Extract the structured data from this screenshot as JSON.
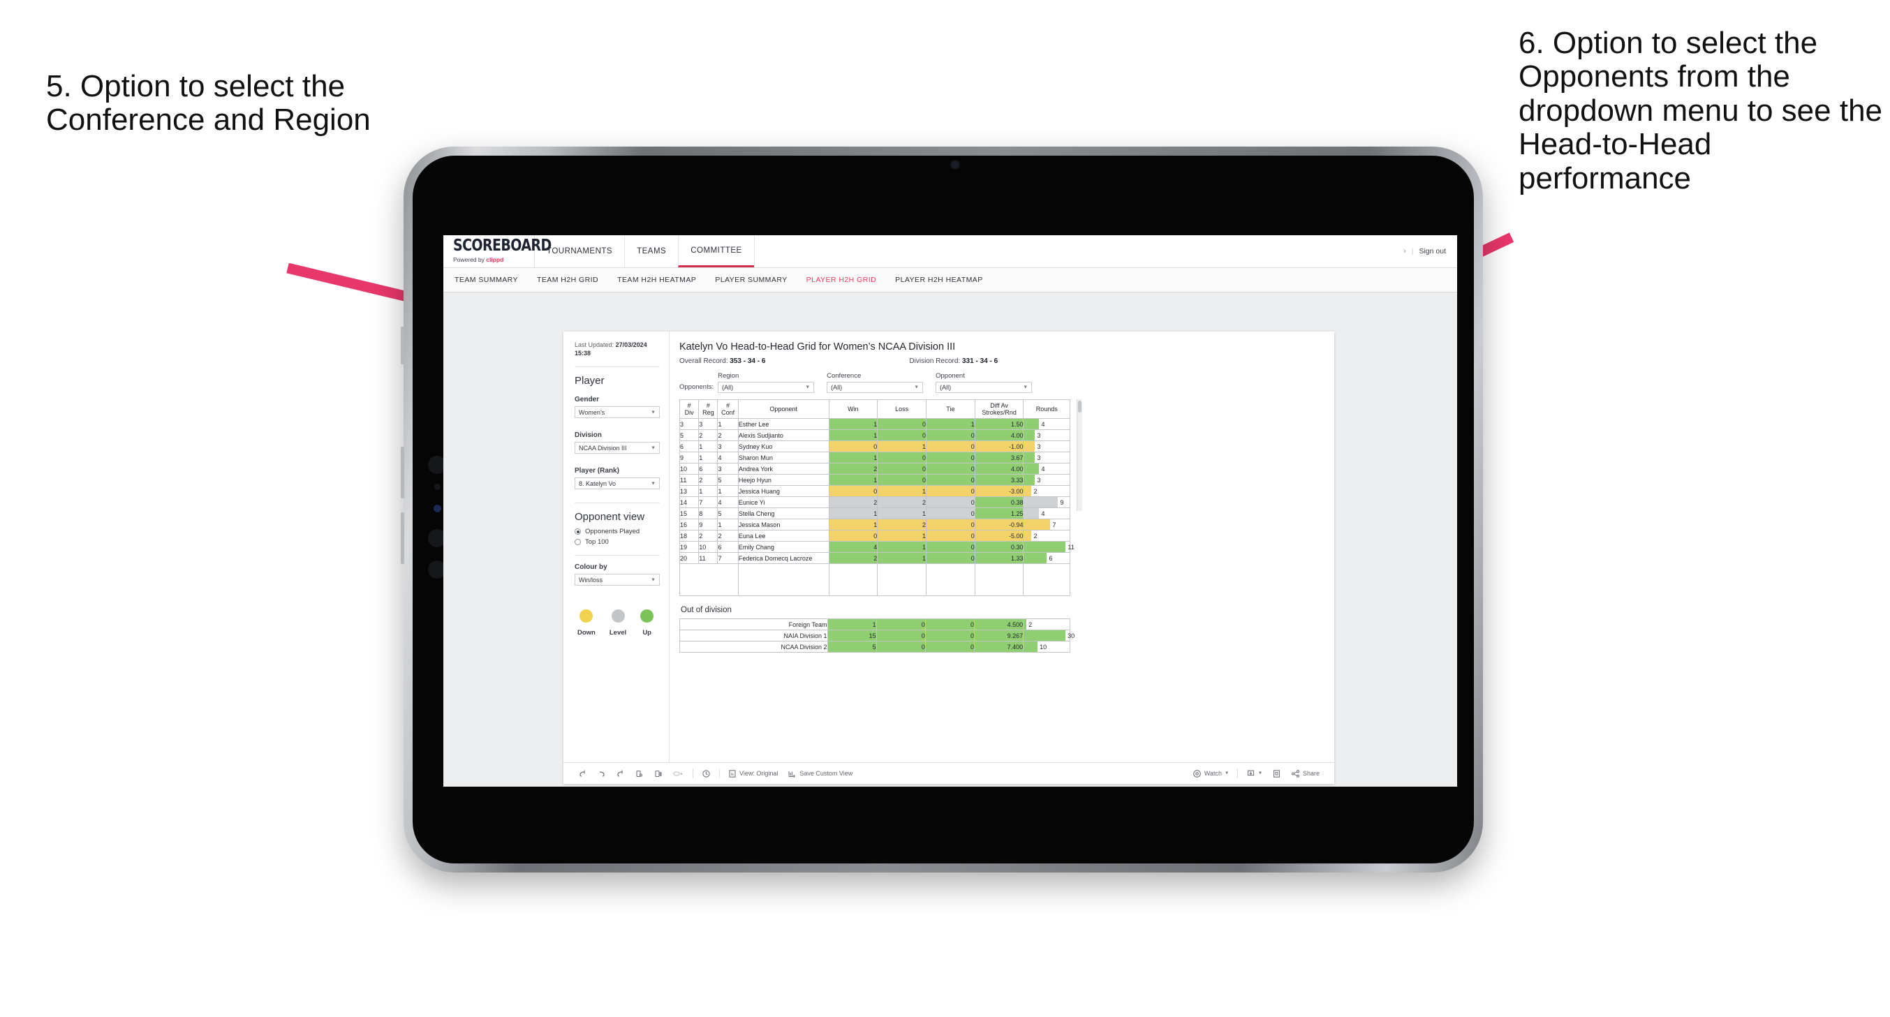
{
  "annotations": {
    "left": "5. Option to select the Conference and Region",
    "right": "6. Option to select the Opponents from the dropdown menu to see the Head-to-Head performance",
    "arrow_color": "#e8376b"
  },
  "app": {
    "brand": {
      "name": "SCOREBOARD",
      "powered_prefix": "Powered by ",
      "powered_brand": "clippd"
    },
    "nav": [
      {
        "label": "TOURNAMENTS",
        "active": false
      },
      {
        "label": "TEAMS",
        "active": false
      },
      {
        "label": "COMMITTEE",
        "active": true
      }
    ],
    "nav_right": {
      "chevron": "›",
      "separator": "|",
      "sign_out": "Sign out"
    },
    "subnav": [
      {
        "label": "TEAM SUMMARY",
        "active": false
      },
      {
        "label": "TEAM H2H GRID",
        "active": false
      },
      {
        "label": "TEAM H2H HEATMAP",
        "active": false
      },
      {
        "label": "PLAYER SUMMARY",
        "active": false
      },
      {
        "label": "PLAYER H2H GRID",
        "active": true
      },
      {
        "label": "PLAYER H2H HEATMAP",
        "active": false
      }
    ],
    "accent": "#ef3b5f"
  },
  "rail": {
    "last_updated_label": "Last Updated:",
    "last_updated_value": "27/03/2024 15:38",
    "player_heading": "Player",
    "gender_label": "Gender",
    "gender_value": "Women’s",
    "division_label": "Division",
    "division_value": "NCAA Division III",
    "player_rank_label": "Player (Rank)",
    "player_rank_value": "8. Katelyn Vo",
    "opponent_view_heading": "Opponent view",
    "opponent_view_options": [
      {
        "label": "Opponents Played",
        "selected": true
      },
      {
        "label": "Top 100",
        "selected": false
      }
    ],
    "colour_by_label": "Colour by",
    "colour_by_value": "Win/loss",
    "legend": [
      {
        "label": "Down",
        "color": "#f2d24f"
      },
      {
        "label": "Level",
        "color": "#c3c6c9"
      },
      {
        "label": "Up",
        "color": "#7cc35a"
      }
    ]
  },
  "viz": {
    "title": "Katelyn Vo Head-to-Head Grid for Women’s NCAA Division III",
    "overall_record_label": "Overall Record:",
    "overall_record_value": "353 - 34 - 6",
    "division_record_label": "Division Record:",
    "division_record_value": "331 - 34 - 6",
    "opponents_label": "Opponents:",
    "filters": [
      {
        "label": "Region",
        "value": "(All)"
      },
      {
        "label": "Conference",
        "value": "(All)"
      },
      {
        "label": "Opponent",
        "value": "(All)"
      }
    ],
    "out_of_division_heading": "Out of division"
  },
  "chart_data": {
    "type": "table",
    "title": "Katelyn Vo Head-to-Head Grid for Women’s NCAA Division III",
    "columns": [
      "# Div",
      "# Reg",
      "# Conf",
      "Opponent",
      "Win",
      "Loss",
      "Tie",
      "Diff Av Strokes/Rnd",
      "Rounds"
    ],
    "column_headers_multiline": [
      [
        "#",
        "Div"
      ],
      [
        "#",
        "Reg"
      ],
      [
        "#",
        "Conf"
      ],
      [
        "Opponent"
      ],
      [
        "Win"
      ],
      [
        "Loss"
      ],
      [
        "Tie"
      ],
      [
        "Diff Av",
        "Strokes/Rnd"
      ],
      [
        "Rounds"
      ]
    ],
    "rounds_max": 11,
    "colour_legend": {
      "up": "#8fce71",
      "down": "#f3d368",
      "level": "#cfd1d3"
    },
    "rows": [
      {
        "div": "3",
        "reg": "3",
        "conf": "1",
        "opponent": "Esther Lee",
        "win": "1",
        "loss": "0",
        "tie": "1",
        "diff": "1.50",
        "rounds": "4",
        "state": "up"
      },
      {
        "div": "5",
        "reg": "2",
        "conf": "2",
        "opponent": "Alexis Sudjianto",
        "win": "1",
        "loss": "0",
        "tie": "0",
        "diff": "4.00",
        "rounds": "3",
        "state": "up"
      },
      {
        "div": "6",
        "reg": "1",
        "conf": "3",
        "opponent": "Sydney Kuo",
        "win": "0",
        "loss": "1",
        "tie": "0",
        "diff": "-1.00",
        "rounds": "3",
        "state": "down"
      },
      {
        "div": "9",
        "reg": "1",
        "conf": "4",
        "opponent": "Sharon Mun",
        "win": "1",
        "loss": "0",
        "tie": "0",
        "diff": "3.67",
        "rounds": "3",
        "state": "up"
      },
      {
        "div": "10",
        "reg": "6",
        "conf": "3",
        "opponent": "Andrea York",
        "win": "2",
        "loss": "0",
        "tie": "0",
        "diff": "4.00",
        "rounds": "4",
        "state": "up"
      },
      {
        "div": "11",
        "reg": "2",
        "conf": "5",
        "opponent": "Heejo Hyun",
        "win": "1",
        "loss": "0",
        "tie": "0",
        "diff": "3.33",
        "rounds": "3",
        "state": "up"
      },
      {
        "div": "13",
        "reg": "1",
        "conf": "1",
        "opponent": "Jessica Huang",
        "win": "0",
        "loss": "1",
        "tie": "0",
        "diff": "-3.00",
        "rounds": "2",
        "state": "down"
      },
      {
        "div": "14",
        "reg": "7",
        "conf": "4",
        "opponent": "Eunice Yi",
        "win": "2",
        "loss": "2",
        "tie": "0",
        "diff": "0.38",
        "rounds": "9",
        "state": "level",
        "diff_state": "up"
      },
      {
        "div": "15",
        "reg": "8",
        "conf": "5",
        "opponent": "Stella Cheng",
        "win": "1",
        "loss": "1",
        "tie": "0",
        "diff": "1.25",
        "rounds": "4",
        "state": "level",
        "diff_state": "up"
      },
      {
        "div": "16",
        "reg": "9",
        "conf": "1",
        "opponent": "Jessica Mason",
        "win": "1",
        "loss": "2",
        "tie": "0",
        "diff": "-0.94",
        "rounds": "7",
        "state": "down"
      },
      {
        "div": "18",
        "reg": "2",
        "conf": "2",
        "opponent": "Euna Lee",
        "win": "0",
        "loss": "1",
        "tie": "0",
        "diff": "-5.00",
        "rounds": "2",
        "state": "down"
      },
      {
        "div": "19",
        "reg": "10",
        "conf": "6",
        "opponent": "Emily Chang",
        "win": "4",
        "loss": "1",
        "tie": "0",
        "diff": "0.30",
        "rounds": "11",
        "state": "up"
      },
      {
        "div": "20",
        "reg": "11",
        "conf": "7",
        "opponent": "Federica Domecq Lacroze",
        "win": "2",
        "loss": "1",
        "tie": "0",
        "diff": "1.33",
        "rounds": "6",
        "state": "up"
      }
    ],
    "out_of_division": {
      "heading": "Out of division",
      "rounds_max": 30,
      "rows": [
        {
          "label": "Foreign Team",
          "win": "1",
          "loss": "0",
          "tie": "0",
          "diff": "4.500",
          "rounds": "2",
          "state": "up"
        },
        {
          "label": "NAIA Division 1",
          "win": "15",
          "loss": "0",
          "tie": "0",
          "diff": "9.267",
          "rounds": "30",
          "state": "up"
        },
        {
          "label": "NCAA Division 2",
          "win": "5",
          "loss": "0",
          "tie": "0",
          "diff": "7.400",
          "rounds": "10",
          "state": "up"
        }
      ]
    }
  },
  "toolbar": {
    "view_label": "View: Original",
    "save_label": "Save Custom View",
    "watch_label": "Watch",
    "share_label": "Share"
  }
}
